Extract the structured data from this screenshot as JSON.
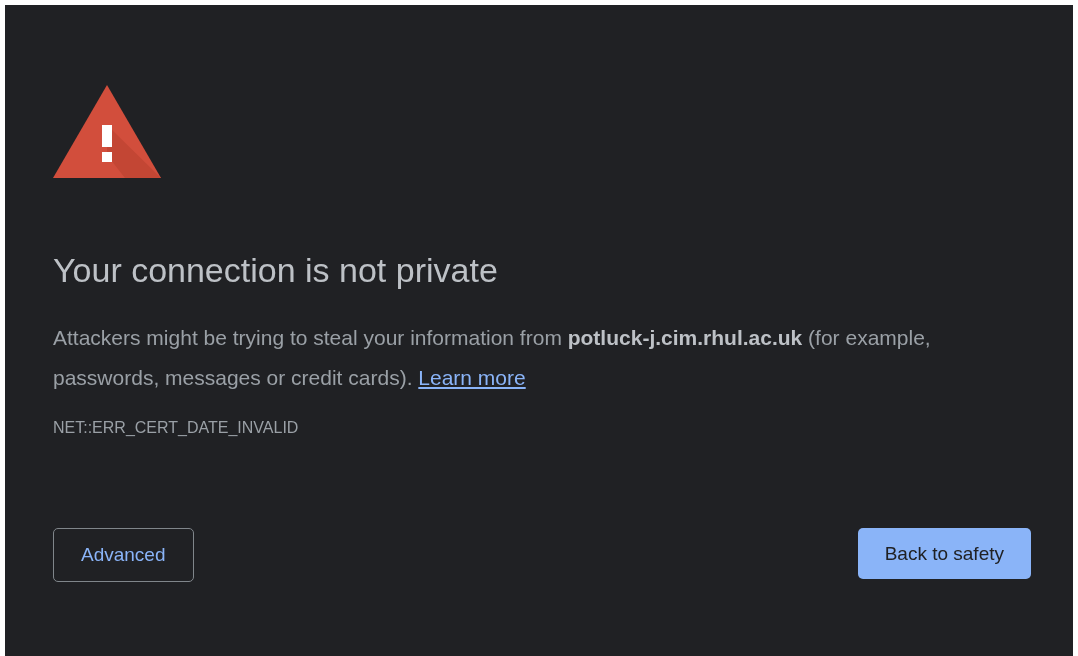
{
  "heading": "Your connection is not private",
  "message": "Attackers might be trying to steal your information from **potluck-j.cim.rhul.ac.uk** (for example, passwords, messages or credit cards).",
  "learn_more": "Learn more",
  "error_code": "NET::ERR_CERT_DATE_INVALID",
  "buttons": [
    {
      "label": "Advanced",
      "kind": "secondary"
    },
    {
      "label": "Back to safety",
      "kind": "primary"
    }
  ]
}
